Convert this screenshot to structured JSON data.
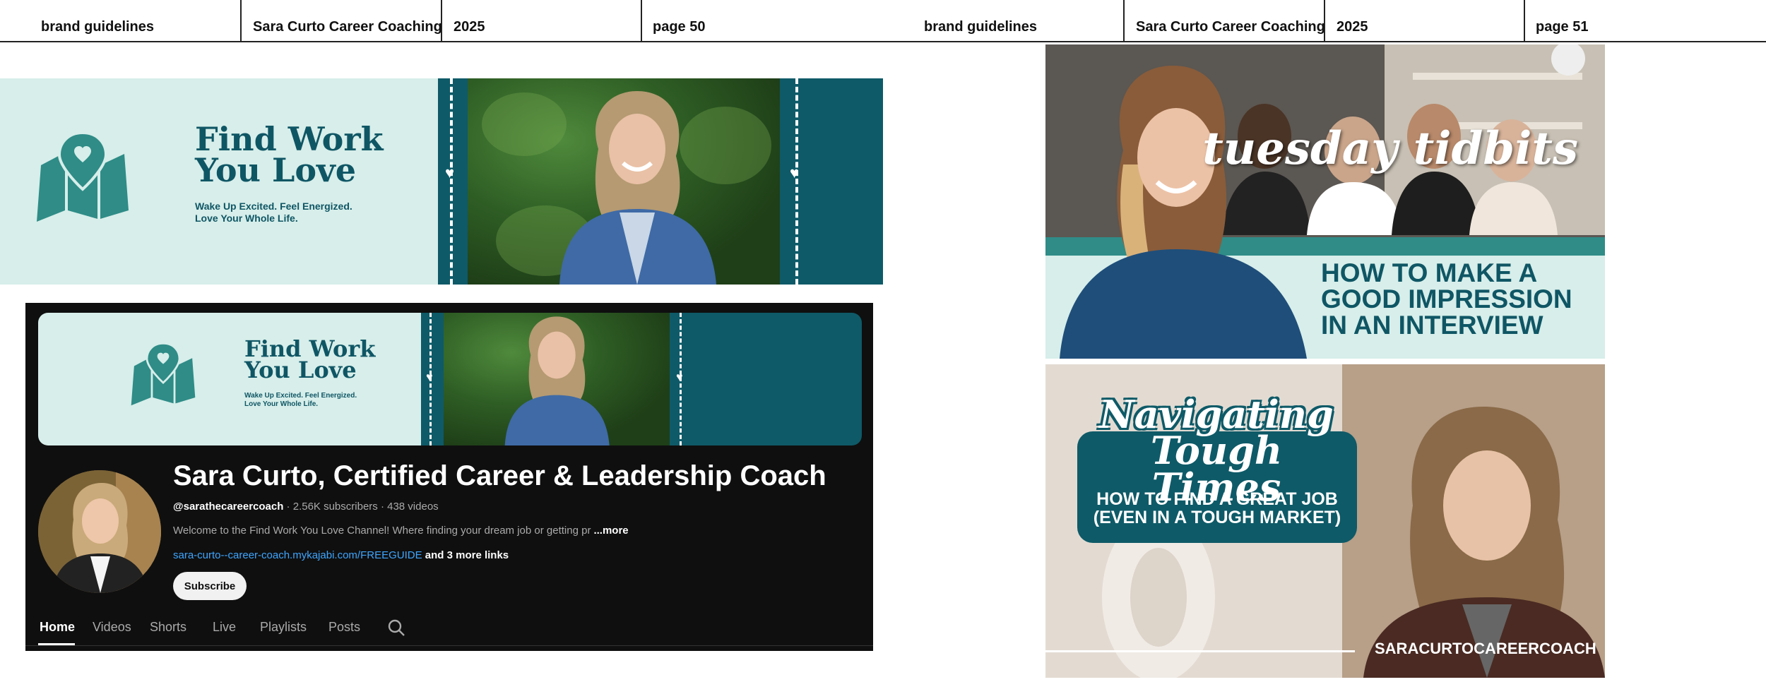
{
  "header_left": {
    "brand": "brand guidelines",
    "company": "Sara Curto Career Coaching",
    "year": "2025",
    "page": "page 50"
  },
  "header_right": {
    "brand": "brand guidelines",
    "company": "Sara Curto Career Coaching",
    "year": "2025",
    "page": "page 51"
  },
  "banner": {
    "title_line1": "Find Work",
    "title_line2": "You Love",
    "tagline_line1": "Wake Up Excited. Feel Energized.",
    "tagline_line2": "Love Your Whole Life."
  },
  "youtube": {
    "channel_name": "Sara Curto, Certified Career & Leadership Coach",
    "handle": "@sarathecareercoach",
    "stats": " · 2.56K subscribers · 438 videos",
    "description": "Welcome to the Find Work You Love Channel!  Where finding your dream job or getting pr",
    "more": "...more",
    "link": "sara-curto--career-coach.mykajabi.com/FREEGUIDE",
    "more_links": " and 3 more links",
    "subscribe": "Subscribe",
    "tabs": [
      "Home",
      "Videos",
      "Shorts",
      "Live",
      "Playlists",
      "Posts"
    ],
    "active_tab": "Home"
  },
  "thumb1": {
    "script_title": "tuesday tidbits",
    "headline_line1": "HOW TO MAKE A",
    "headline_line2": "GOOD IMPRESSION",
    "headline_line3": "IN AN INTERVIEW"
  },
  "thumb2": {
    "script_line1": "Navigating",
    "script_line2": "Tough Times",
    "sub_line1": "HOW TO FIND A GREAT JOB",
    "sub_line2": "(EVEN IN A TOUGH MARKET)",
    "handle": "SARACURTOCAREERCOACH"
  },
  "colors": {
    "teal_dark": "#0e5a68",
    "mint": "#d7eeea",
    "teal_icon": "#2f8c87",
    "youtube_bg": "#0f0f0f",
    "link_blue": "#3ea6ff"
  }
}
